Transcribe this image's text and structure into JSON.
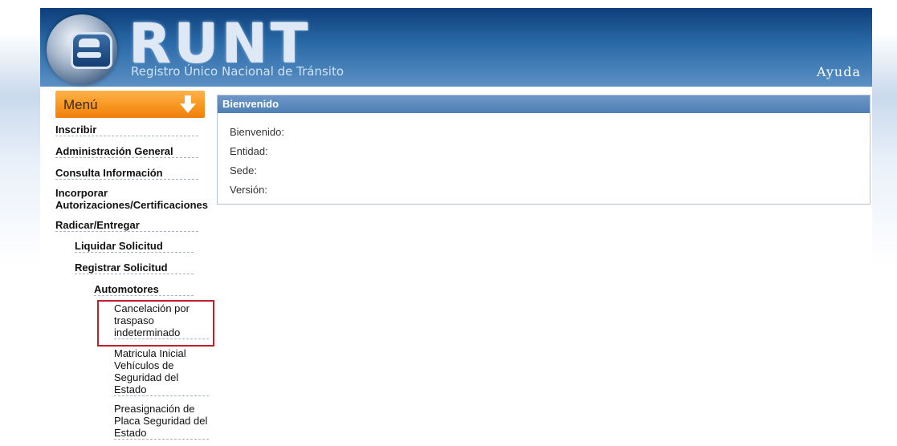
{
  "header": {
    "logo_text": "RUNT",
    "subtitle": "Registro Único Nacional de Tránsito",
    "help": "Ayuda"
  },
  "menu": {
    "title": "Menú",
    "items": [
      {
        "label": "Inscribir"
      },
      {
        "label": "Administración General"
      },
      {
        "label": "Consulta Información"
      },
      {
        "label": "Incorporar Autorizaciones/Certificaciones"
      },
      {
        "label": "Radicar/Entregar"
      }
    ],
    "radicar": {
      "liquidar": "Liquidar Solicitud",
      "registrar": "Registrar Solicitud",
      "automotores": "Automotores",
      "automotores_items": [
        {
          "label": "Cancelación por traspaso indeterminado"
        },
        {
          "label": "Matricula Inicial Vehículos de Seguridad del Estado"
        },
        {
          "label": "Preasignación de Placa Seguridad del Estado"
        }
      ]
    }
  },
  "welcome": {
    "title": "Bienvenido",
    "fields": [
      {
        "label": "Bienvenido:"
      },
      {
        "label": "Entidad:"
      },
      {
        "label": "Sede:"
      },
      {
        "label": "Versión:"
      }
    ]
  }
}
